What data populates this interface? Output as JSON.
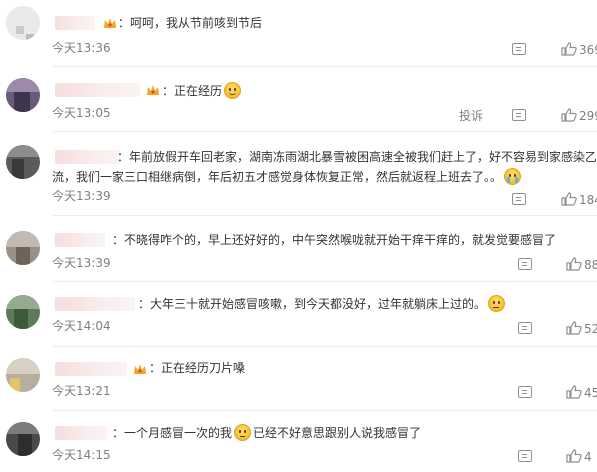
{
  "comments": [
    {
      "text": "：呵呵，我从节前咳到节后",
      "emoji": "",
      "text2": "",
      "time": "今天13:36",
      "likes": "369",
      "report": ""
    },
    {
      "text": "：正在经历",
      "emoji": "smile-emoji",
      "text2": "",
      "time": "今天13:05",
      "likes": "299",
      "report": "投诉"
    },
    {
      "text": "：年前放假开车回老家，湖南冻雨湖北暴雪被困高速全被我们赶上了，好不容易到家感染乙",
      "line2": "流，我们一家三口相继病倒，年后初五才感觉身体恢复正常，然后就返程上班去了。。",
      "emoji": "cry-emoji",
      "time": "今天13:39",
      "likes": "184",
      "report": ""
    },
    {
      "text": "：不晓得咋个的，早上还好好的，中午突然喉咙就开始干痒干痒的，就发觉要感冒了",
      "emoji": "",
      "time": "今天13:39",
      "likes": "88",
      "report": ""
    },
    {
      "text": "：大年三十就开始感冒咳嗽，到今天都没好，过年就躺床上过的。",
      "emoji": "smirk-emoji",
      "time": "今天14:04",
      "likes": "52",
      "report": ""
    },
    {
      "text": "：正在经历刀片嗓",
      "emoji": "",
      "time": "今天13:21",
      "likes": "45",
      "report": ""
    },
    {
      "text": "：一个月感冒一次的我",
      "emoji": "thinking-emoji",
      "text2": "已经不好意思跟别人说我感冒了",
      "time": "今天14:15",
      "likes": "4",
      "report": ""
    }
  ],
  "colors": {
    "text": "#333333",
    "meta": "#808080",
    "crown": "#f5a623"
  }
}
